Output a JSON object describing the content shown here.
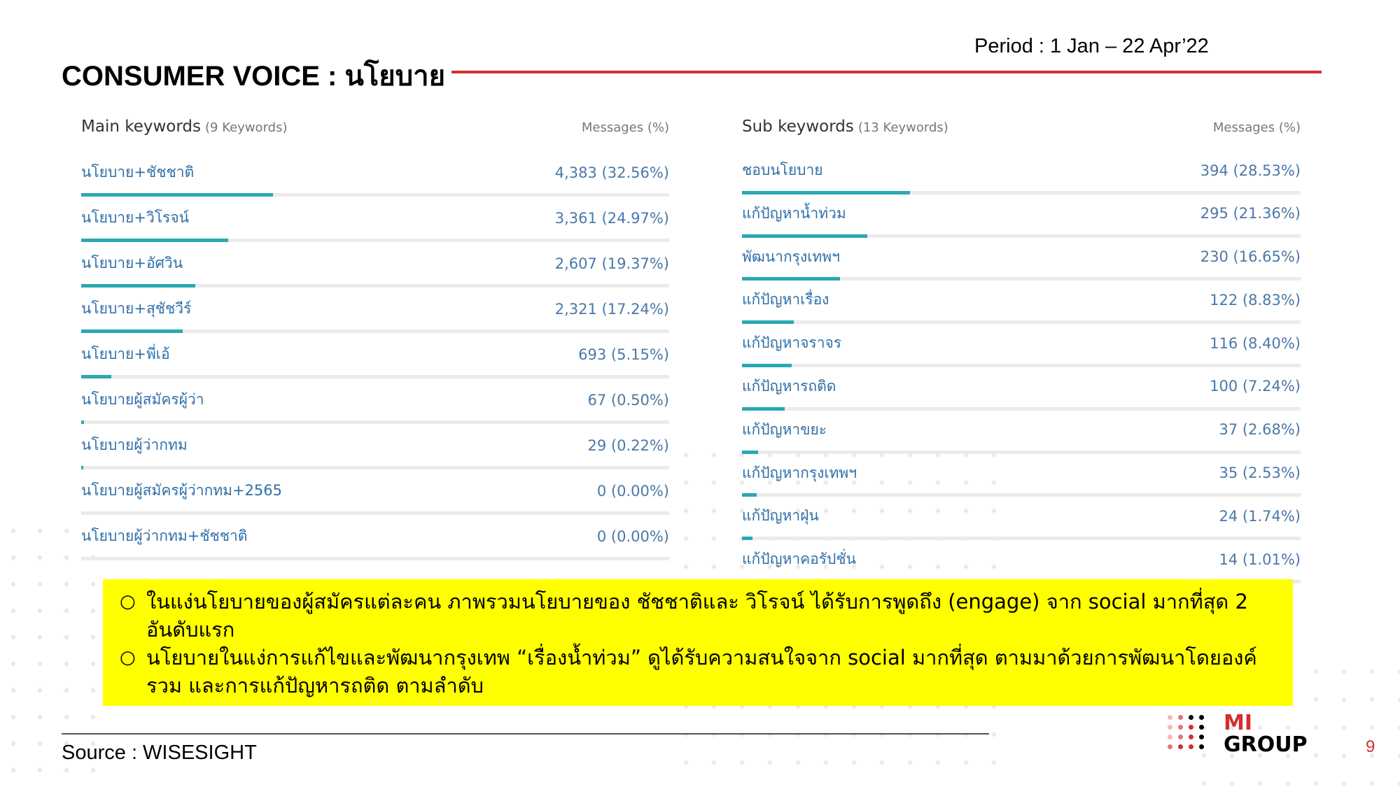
{
  "header": {
    "title": "CONSUMER VOICE : นโยบาย",
    "period": "Period : 1 Jan – 22 Apr’22"
  },
  "main_keywords": {
    "title": "Main keywords",
    "count": "(9 Keywords)",
    "column": "Messages (%)",
    "items": [
      {
        "label": "นโยบาย+ชัชชาติ",
        "value": "4,383 (32.56%)",
        "share": 32.56
      },
      {
        "label": "นโยบาย+วิโรจน์",
        "value": "3,361 (24.97%)",
        "share": 24.97
      },
      {
        "label": "นโยบาย+อัศวิน",
        "value": "2,607 (19.37%)",
        "share": 19.37
      },
      {
        "label": "นโยบาย+สุชัชวีร์",
        "value": "2,321 (17.24%)",
        "share": 17.24
      },
      {
        "label": "นโยบาย+พี่เอ้",
        "value": "693 (5.15%)",
        "share": 5.15
      },
      {
        "label": "นโยบายผู้สมัครผู้ว่า",
        "value": "67 (0.50%)",
        "share": 0.5
      },
      {
        "label": "นโยบายผู้ว่ากทม",
        "value": "29 (0.22%)",
        "share": 0.22
      },
      {
        "label": "นโยบายผู้สมัครผู้ว่ากทม+2565",
        "value": "0 (0.00%)",
        "share": 0
      },
      {
        "label": "นโยบายผู้ว่ากทม+ชัชชาติ",
        "value": "0 (0.00%)",
        "share": 0
      }
    ]
  },
  "sub_keywords": {
    "title": "Sub keywords",
    "count": "(13 Keywords)",
    "column": "Messages (%)",
    "items": [
      {
        "label": "ชอบนโยบาย",
        "value": "394 (28.53%)",
        "share": 28.53
      },
      {
        "label": "แก้ปัญหาน้ำท่วม",
        "value": "295 (21.36%)",
        "share": 21.36
      },
      {
        "label": "พัฒนากรุงเทพฯ",
        "value": "230 (16.65%)",
        "share": 16.65
      },
      {
        "label": "แก้ปัญหาเรื่อง",
        "value": "122 (8.83%)",
        "share": 8.83
      },
      {
        "label": "แก้ปัญหาจราจร",
        "value": "116 (8.40%)",
        "share": 8.4
      },
      {
        "label": "แก้ปัญหารถติด",
        "value": "100 (7.24%)",
        "share": 7.24
      },
      {
        "label": "แก้ปัญหาขยะ",
        "value": "37 (2.68%)",
        "share": 2.68
      },
      {
        "label": "แก้ปัญหากรุงเทพฯ",
        "value": "35 (2.53%)",
        "share": 2.53
      },
      {
        "label": "แก้ปัญหาฝุ่น",
        "value": "24 (1.74%)",
        "share": 1.74
      },
      {
        "label": "แก้ปัญหาคอรัปชั่น",
        "value": "14 (1.01%)",
        "share": 1.01
      }
    ]
  },
  "notes": [
    "ในแง่นโยบายของผู้สมัครแต่ละคน ภาพรวมนโยบายของ ชัชชาติและ วิโรจน์ ได้รับการพูดถึง (engage) จาก social มากที่สุด 2 อันดับแรก",
    "นโยบายในแง่การแก้ไขและพัฒนากรุงเทพ “เรื่องน้ำท่วม” ดูได้รับความสนใจจาก social มากที่สุด ตามมาด้วยการพัฒนาโดยองค์รวม และการแก้ปัญหารถติด ตามลำดับ"
  ],
  "footer": {
    "source": "Source : WISESIGHT",
    "page_number": "9",
    "logo_line1": "MI",
    "logo_line2": "GROUP"
  },
  "colors": {
    "accent_red": "#d32f2f",
    "bar_teal": "#2aa8b1",
    "highlight_yellow": "#ffff00",
    "keyword_blue": "#2f6fa8"
  }
}
